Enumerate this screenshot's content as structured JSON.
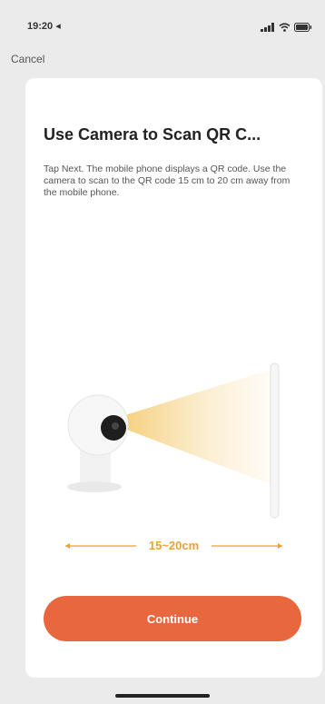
{
  "status_bar": {
    "time": "19:20 ◂",
    "signal_icon": "signal-icon",
    "wifi_icon": "wifi-icon",
    "battery_icon": "battery-icon"
  },
  "nav": {
    "cancel_label": "Cancel"
  },
  "card": {
    "title": "Use Camera to Scan QR C...",
    "description": "Tap Next. The mobile phone displays a QR code. Use the camera to scan to the QR code 15 cm to 20 cm away from the mobile phone.",
    "distance_label": "15~20cm",
    "continue_label": "Continue"
  },
  "colors": {
    "accent": "#e8673e",
    "distance": "#e8a23a",
    "background": "#ebebeb",
    "card": "#ffffff"
  }
}
